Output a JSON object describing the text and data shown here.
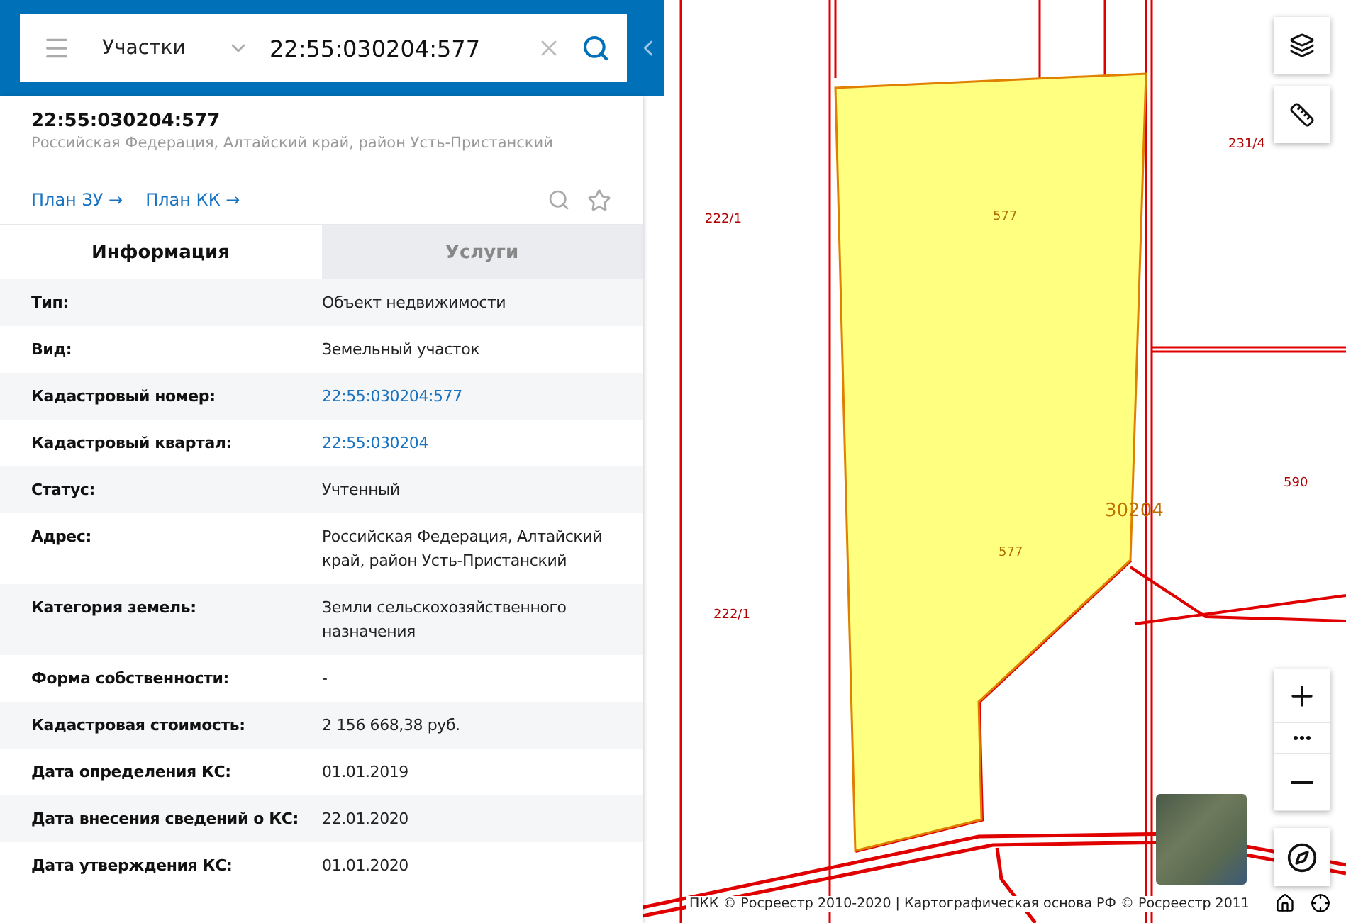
{
  "search": {
    "layer": "Участки",
    "value": "22:55:030204:577"
  },
  "object": {
    "title": "22:55:030204:577",
    "address": "Российская Федерация, Алтайский край, район Усть-Пристанский",
    "links": [
      "План ЗУ →",
      "План КК →"
    ]
  },
  "tabs": [
    {
      "label": "Информация",
      "selected": true
    },
    {
      "label": "Услуги",
      "selected": false
    }
  ],
  "properties": [
    {
      "label": "Тип:",
      "value": "Объект недвижимости",
      "kind": "text"
    },
    {
      "label": "Вид:",
      "value": "Земельный участок",
      "kind": "text"
    },
    {
      "label": "Кадастровый номер:",
      "value": "22:55:030204:577",
      "kind": "link"
    },
    {
      "label": "Кадастровый квартал:",
      "value": "22:55:030204",
      "kind": "link"
    },
    {
      "label": "Статус:",
      "value": "Учтенный",
      "kind": "text"
    },
    {
      "label": "Адрес:",
      "value": "Российская Федерация, Алтайский край, район Усть-Пристанский",
      "kind": "text"
    },
    {
      "label": "Категория земель:",
      "value": "Земли сельскохозяйственного назначения",
      "kind": "text"
    },
    {
      "label": "Форма собственности:",
      "value": "-",
      "kind": "text"
    },
    {
      "label": "Кадастровая стоимость:",
      "value": "2 156 668,38 руб.",
      "kind": "text"
    },
    {
      "label": "Дата определения КС:",
      "value": "01.01.2019",
      "kind": "text"
    },
    {
      "label": "Дата внесения сведений о КС:",
      "value": "22.01.2020",
      "kind": "text"
    },
    {
      "label": "Дата утверждения КС:",
      "value": "01.01.2020",
      "kind": "text"
    }
  ],
  "map": {
    "labels": [
      {
        "text": "222/1",
        "kind": "parcel"
      },
      {
        "text": "577",
        "kind": "selected"
      },
      {
        "text": "231/4",
        "kind": "parcel"
      },
      {
        "text": "30204",
        "kind": "quarter"
      },
      {
        "text": "590",
        "kind": "parcel"
      },
      {
        "text": "577",
        "kind": "selected"
      },
      {
        "text": "222/1",
        "kind": "parcel"
      }
    ],
    "attribution": "ПКК © Росреестр 2010-2020 | Картографическая основа РФ © Росреестр 2011"
  }
}
